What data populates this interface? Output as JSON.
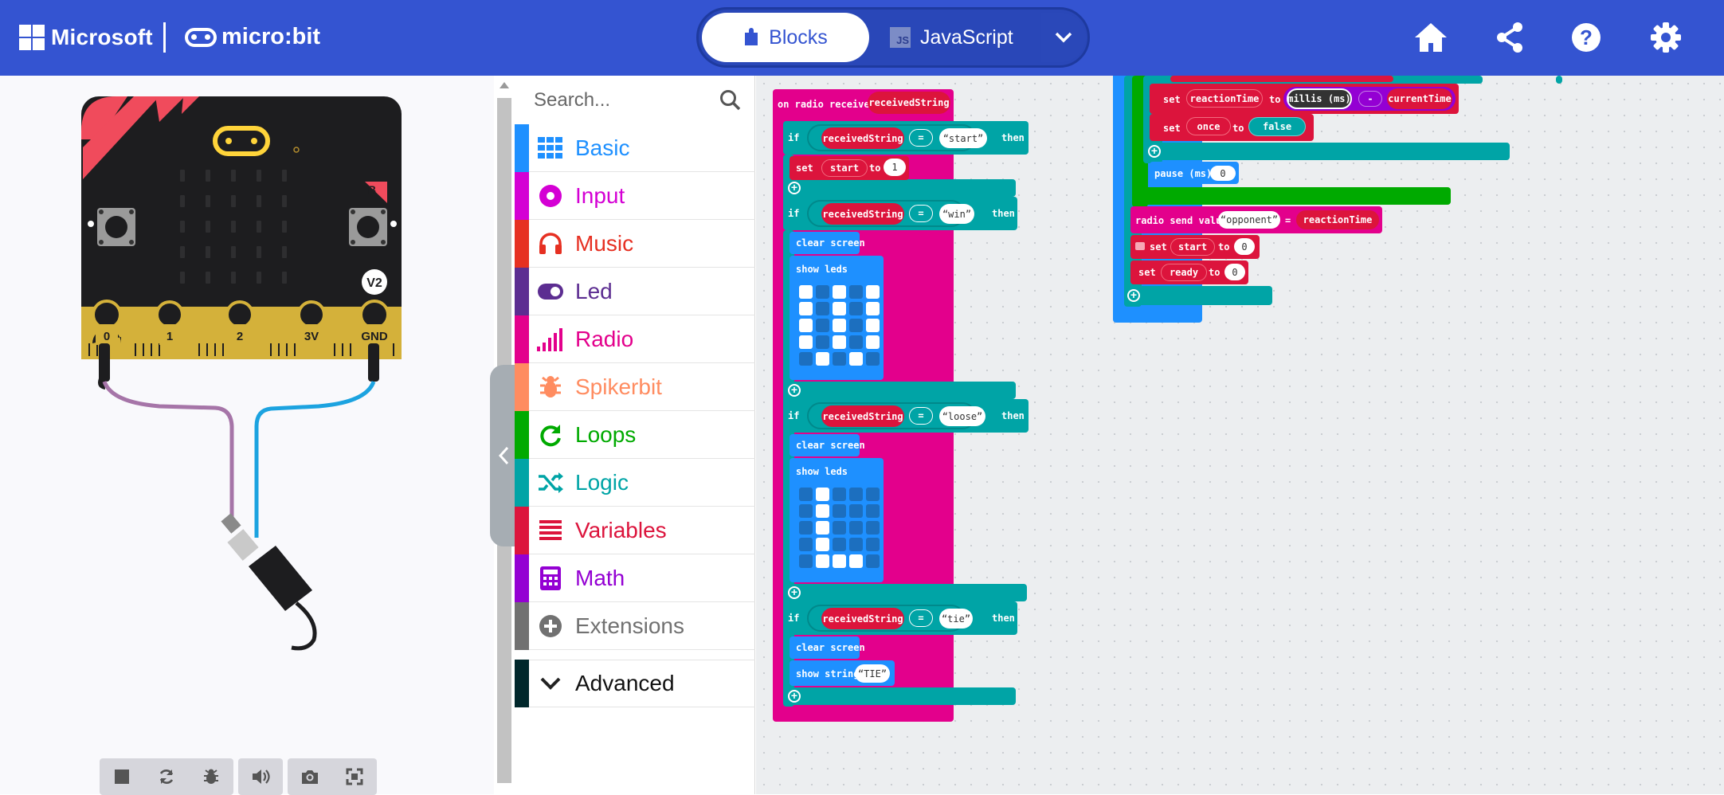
{
  "header": {
    "microsoft_label": "Microsoft",
    "microbit_label": "micro:bit",
    "tabs": {
      "blocks": "Blocks",
      "javascript": "JavaScript",
      "js_badge": "JS"
    },
    "colors": {
      "bar": "#3454d1"
    }
  },
  "simulator": {
    "pins": [
      "0",
      "1",
      "2",
      "3V",
      "GND"
    ],
    "button_a": "A",
    "button_b": "B",
    "version_badge": "V2"
  },
  "toolbox": {
    "search_placeholder": "Search...",
    "categories": [
      {
        "label": "Basic",
        "color": "#1e90ff",
        "icon": "grid-icon"
      },
      {
        "label": "Input",
        "color": "#d400d4",
        "icon": "input-circle-icon"
      },
      {
        "label": "Music",
        "color": "#e63022",
        "icon": "headphones-icon"
      },
      {
        "label": "Led",
        "color": "#5c2d91",
        "icon": "toggle-icon"
      },
      {
        "label": "Radio",
        "color": "#e3008c",
        "icon": "signal-bars-icon"
      },
      {
        "label": "Spikerbit",
        "color": "#ff8c60",
        "icon": "bug-icon"
      },
      {
        "label": "Loops",
        "color": "#00aa00",
        "icon": "loop-arrow-icon"
      },
      {
        "label": "Logic",
        "color": "#00a4a6",
        "icon": "shuffle-icon"
      },
      {
        "label": "Variables",
        "color": "#dc143c",
        "icon": "lines-icon"
      },
      {
        "label": "Math",
        "color": "#9400d3",
        "icon": "calculator-icon"
      },
      {
        "label": "Extensions",
        "color": "#717171",
        "icon": "plus-circle-icon"
      }
    ],
    "advanced": {
      "label": "Advanced",
      "color": "#00272b"
    }
  },
  "blocks": {
    "on_radio_received": "on radio received",
    "received_string": "receivedString",
    "if": "if",
    "then": "then",
    "eq": "=",
    "start_str": "start",
    "win_str": "win",
    "loose_str": "loose",
    "tie_str": "tie",
    "set": "set",
    "start_var": "start",
    "to": "to",
    "one": "1",
    "zero": "0",
    "clear_screen": "clear screen",
    "show_leds": "show leds",
    "show_string": "show string",
    "tie_text": "TIE",
    "reaction_time": "reactionTime",
    "millis": "millis (ms)",
    "minus": "-",
    "current_time": "currentTime",
    "once": "once",
    "false": "false",
    "pause": "pause (ms)",
    "radio_send_value": "radio send value",
    "opponent": "opponent",
    "ready": "ready"
  }
}
